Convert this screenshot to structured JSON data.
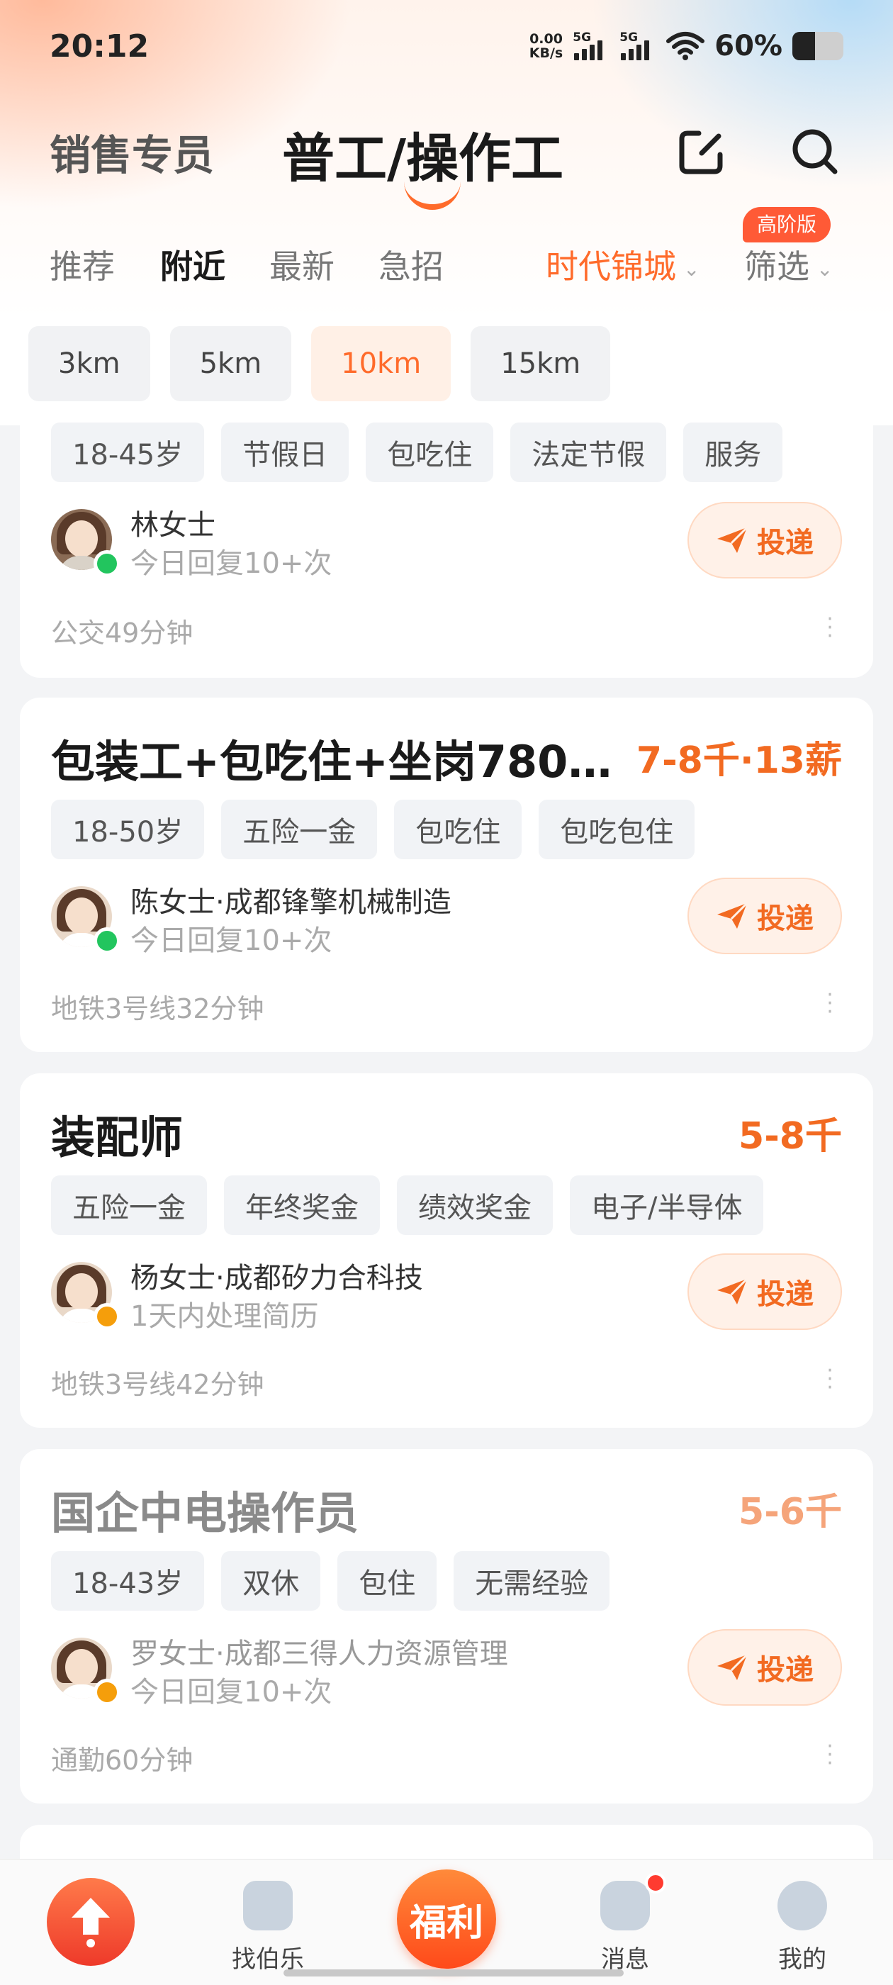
{
  "status_bar": {
    "time": "20:12",
    "net_speed_top": "0.00",
    "net_speed_bottom": "KB/s",
    "sig1_label": "5G",
    "sig2_label": "5G",
    "battery": "60%"
  },
  "header": {
    "job_tab_1": "销售专员",
    "job_tab_2": "普工/操作工",
    "edit_icon": "edit-icon",
    "search_icon": "search-icon"
  },
  "tabs": {
    "items": [
      "推荐",
      "附近",
      "最新",
      "急招"
    ],
    "active_index": 1,
    "location": "时代锦城",
    "filter": "筛选",
    "filter_badge": "高阶版"
  },
  "distance": {
    "options": [
      "3km",
      "5km",
      "10km",
      "15km"
    ],
    "selected": "10km"
  },
  "jobs": [
    {
      "title": "",
      "salary": "",
      "tags": [
        "18-45岁",
        "节假日",
        "包吃住",
        "法定节假",
        "服务"
      ],
      "recruiter": "林女士",
      "status": "今日回复10+次",
      "online": "green",
      "apply": "投递",
      "commute": "公交49分钟"
    },
    {
      "title": "包装工+包吃住+坐岗780…",
      "salary": "7-8千·13薪",
      "tags": [
        "18-50岁",
        "五险一金",
        "包吃住",
        "包吃包住"
      ],
      "recruiter": "陈女士·成都锋擎机械制造",
      "status": "今日回复10+次",
      "online": "green",
      "apply": "投递",
      "commute": "地铁3号线32分钟"
    },
    {
      "title": "装配师",
      "salary": "5-8千",
      "tags": [
        "五险一金",
        "年终奖金",
        "绩效奖金",
        "电子/半导体"
      ],
      "recruiter": "杨女士·成都矽力合科技",
      "status": "1天内处理简历",
      "online": "orange",
      "apply": "投递",
      "commute": "地铁3号线42分钟"
    },
    {
      "title": "国企中电操作员",
      "salary": "5-6千",
      "tags": [
        "18-43岁",
        "双休",
        "包住",
        "无需经验"
      ],
      "recruiter": "罗女士·成都三得人力资源管理",
      "status": "今日回复10+次",
      "online": "orange",
      "apply": "投递",
      "commute": "通勤60分钟"
    }
  ],
  "tabbar": {
    "items": [
      "找伯乐",
      "福利",
      "消息",
      "我的"
    ]
  },
  "colors": {
    "accent": "#f26a21",
    "online": "#22c55e",
    "away": "#f59e0b"
  }
}
